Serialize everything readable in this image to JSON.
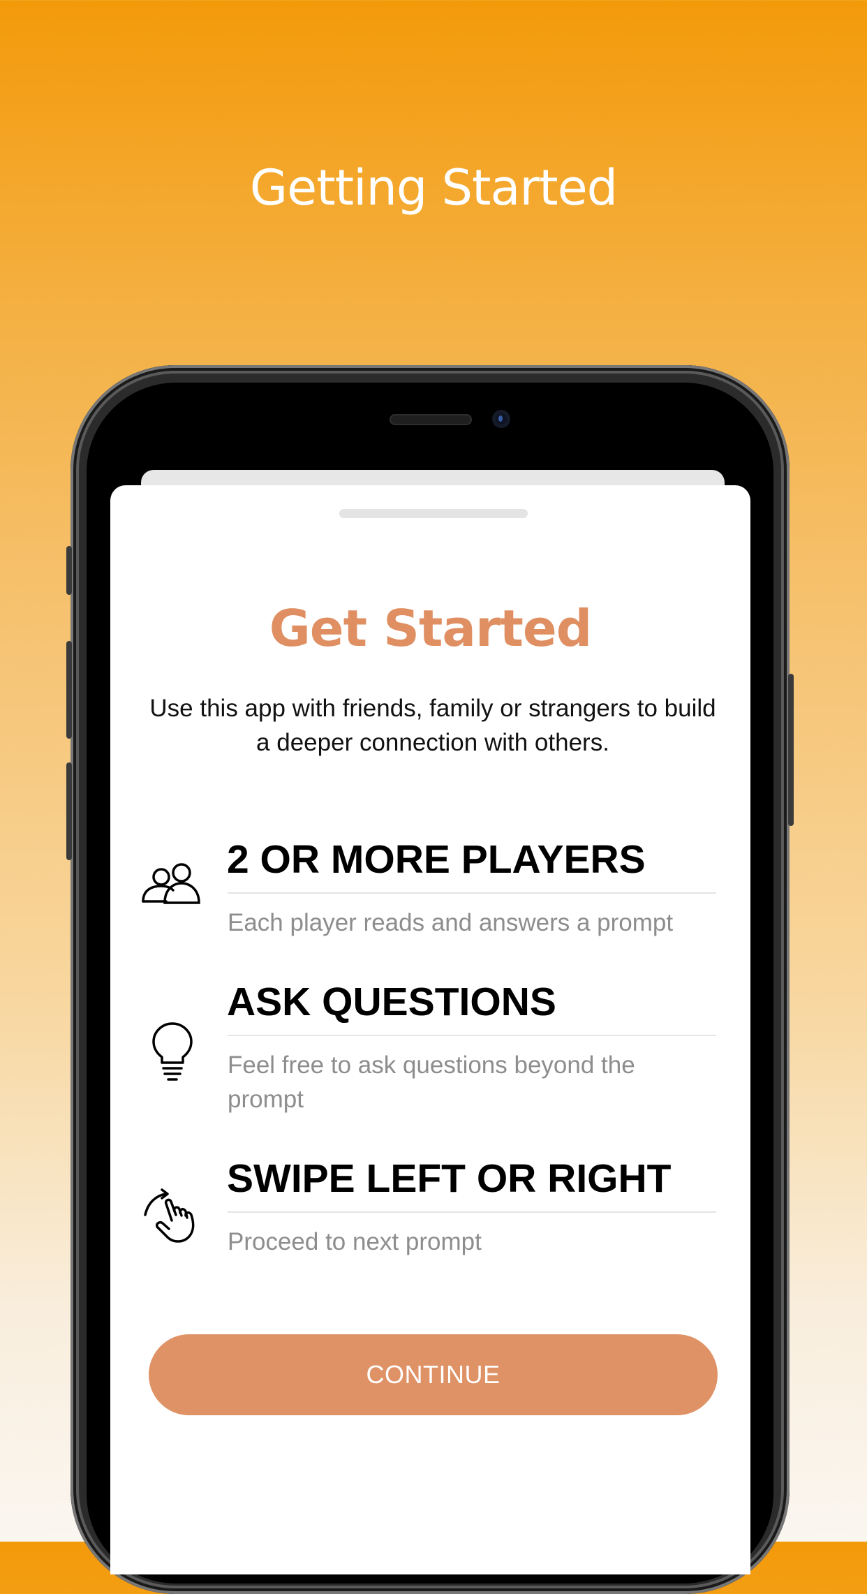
{
  "banner": {
    "headline": "Getting Started"
  },
  "sheet": {
    "title": "Get Started",
    "intro": "Use this app with friends, family or strangers to build a deeper connection with others.",
    "features": [
      {
        "icon": "people-icon",
        "title": "2 OR MORE PLAYERS",
        "description": "Each player reads and answers a prompt"
      },
      {
        "icon": "lightbulb-icon",
        "title": "ASK QUESTIONS",
        "description": "Feel free to ask questions beyond the prompt"
      },
      {
        "icon": "swipe-hand-icon",
        "title": "SWIPE LEFT OR RIGHT",
        "description": "Proceed to next prompt"
      }
    ],
    "continue_label": "CONTINUE"
  },
  "colors": {
    "accent": "#df9265",
    "title": "#df8f62",
    "gradient_top": "#f39a0a",
    "gradient_bottom": "#faf6f0"
  }
}
